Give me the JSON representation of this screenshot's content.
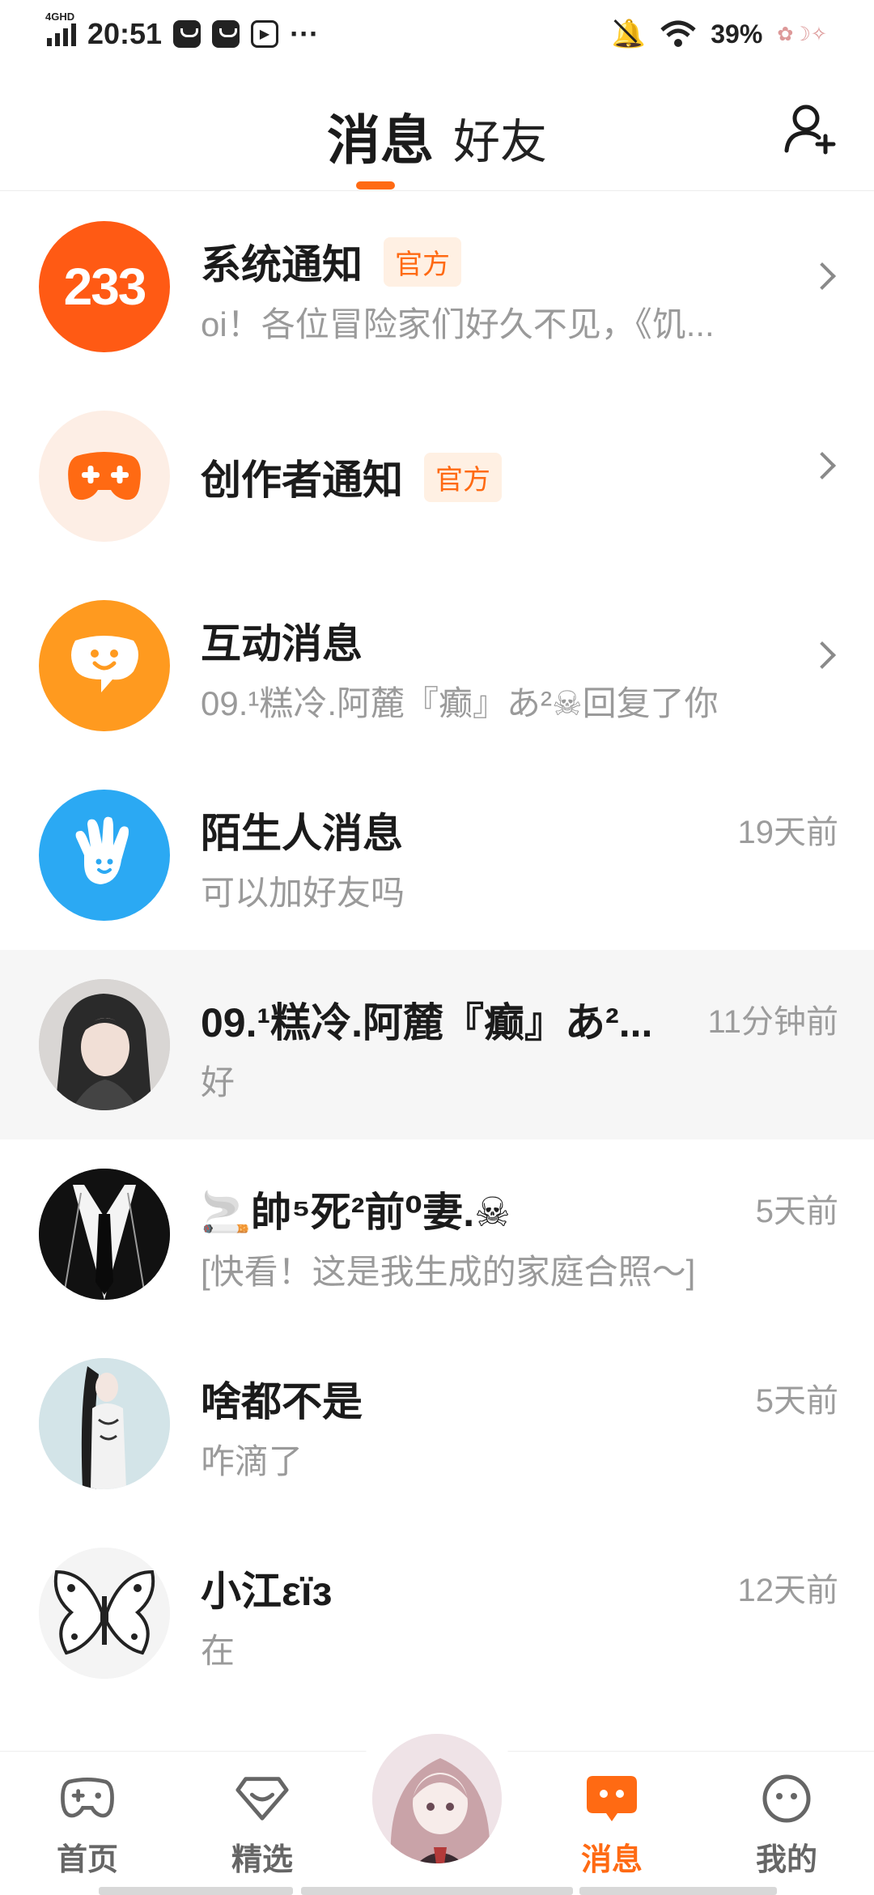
{
  "status_bar": {
    "network": "4GHD",
    "time": "20:51",
    "more": "···",
    "battery": "39%"
  },
  "header": {
    "tabs": [
      {
        "label": "消息",
        "active": true
      },
      {
        "label": "好友",
        "active": false
      }
    ],
    "add_friend_icon": "add-person-icon"
  },
  "conversations": [
    {
      "name": "系统通知",
      "badge": "官方",
      "message": "oi！各位冒险家们好久不见，《饥...",
      "time": "",
      "avatar": "233",
      "chevron": true
    },
    {
      "name": "创作者通知",
      "badge": "官方",
      "message": "",
      "time": "",
      "avatar": "gamepad-plus-icon",
      "chevron": true
    },
    {
      "name": "互动消息",
      "badge": "",
      "message": "09.¹糕冷.阿麓『癫』あ²☠回复了你",
      "time": "",
      "avatar": "chat-bubble-icon",
      "chevron": true
    },
    {
      "name": "陌生人消息",
      "badge": "",
      "message": "可以加好友吗",
      "time": "19天前",
      "avatar": "hand-wave-icon",
      "chevron": false
    },
    {
      "name": "09.¹糕冷.阿麓『癫』あ²...",
      "badge": "",
      "message": "好",
      "time": "11分钟前",
      "avatar": "user-photo",
      "chevron": false,
      "highlighted": true
    },
    {
      "name": "🚬帥⁵死²前⁰妻.☠",
      "badge": "",
      "message": "[快看！这是我生成的家庭合照～]",
      "time": "5天前",
      "avatar": "user-photo",
      "chevron": false
    },
    {
      "name": "啥都不是",
      "badge": "",
      "message": "咋滴了",
      "time": "5天前",
      "avatar": "user-photo",
      "chevron": false
    },
    {
      "name": "小江εïз",
      "badge": "",
      "message": "在",
      "time": "12天前",
      "avatar": "user-photo",
      "chevron": false
    }
  ],
  "bottom_nav": {
    "items": [
      {
        "label": "首页",
        "icon": "gamepad-icon",
        "active": false
      },
      {
        "label": "精选",
        "icon": "heart-diamond-icon",
        "active": false
      },
      {
        "label": "消息",
        "icon": "message-icon",
        "active": true
      },
      {
        "label": "我的",
        "icon": "face-icon",
        "active": false
      }
    ]
  },
  "colors": {
    "accent": "#ff6a13",
    "badge_bg": "#fff0e3",
    "secondary_text": "#9a9a9a",
    "highlight_row": "#f6f6f6"
  }
}
